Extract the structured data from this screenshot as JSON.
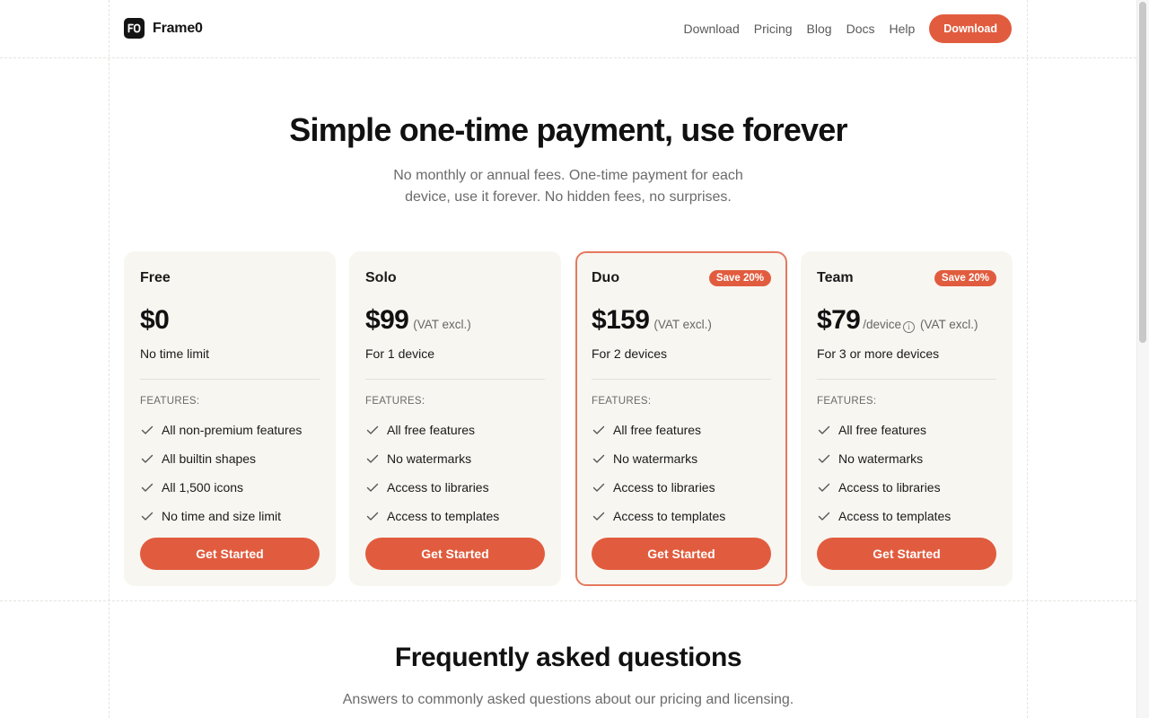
{
  "header": {
    "brand": "Frame0",
    "nav": [
      "Download",
      "Pricing",
      "Blog",
      "Docs",
      "Help"
    ],
    "cta": "Download"
  },
  "hero": {
    "title": "Simple one-time payment, use forever",
    "subtitle": "No monthly or annual fees. One-time payment for each device, use it forever. No hidden fees, no surprises."
  },
  "plans": [
    {
      "name": "Free",
      "badge": "",
      "price": "$0",
      "suffix": "",
      "vat": "",
      "note": "No time limit",
      "features_label": "FEATURES:",
      "features": [
        "All non-premium features",
        "All builtin shapes",
        "All 1,500 icons",
        "No time and size limit"
      ],
      "cta": "Get Started"
    },
    {
      "name": "Solo",
      "badge": "",
      "price": "$99",
      "suffix": "",
      "vat": "(VAT excl.)",
      "note": "For 1 device",
      "features_label": "FEATURES:",
      "features": [
        "All free features",
        "No watermarks",
        "Access to libraries",
        "Access to templates"
      ],
      "cta": "Get Started"
    },
    {
      "name": "Duo",
      "badge": "Save 20%",
      "price": "$159",
      "suffix": "",
      "vat": "(VAT excl.)",
      "note": "For 2 devices",
      "features_label": "FEATURES:",
      "features": [
        "All free features",
        "No watermarks",
        "Access to libraries",
        "Access to templates"
      ],
      "cta": "Get Started"
    },
    {
      "name": "Team",
      "badge": "Save 20%",
      "price": "$79",
      "suffix": "/device",
      "vat": "(VAT excl.)",
      "note": "For 3 or more devices",
      "features_label": "FEATURES:",
      "features": [
        "All free features",
        "No watermarks",
        "Access to libraries",
        "Access to templates"
      ],
      "cta": "Get Started"
    }
  ],
  "faq": {
    "title": "Frequently asked questions",
    "subtitle": "Answers to commonly asked questions about our pricing and licensing."
  },
  "colors": {
    "accent": "#e15c3e",
    "card_bg": "#f8f6f1",
    "featured_border": "#e4795f"
  },
  "icons": {
    "brand": "frame0-logo-icon",
    "feature": "check-icon",
    "info": "info-icon"
  }
}
